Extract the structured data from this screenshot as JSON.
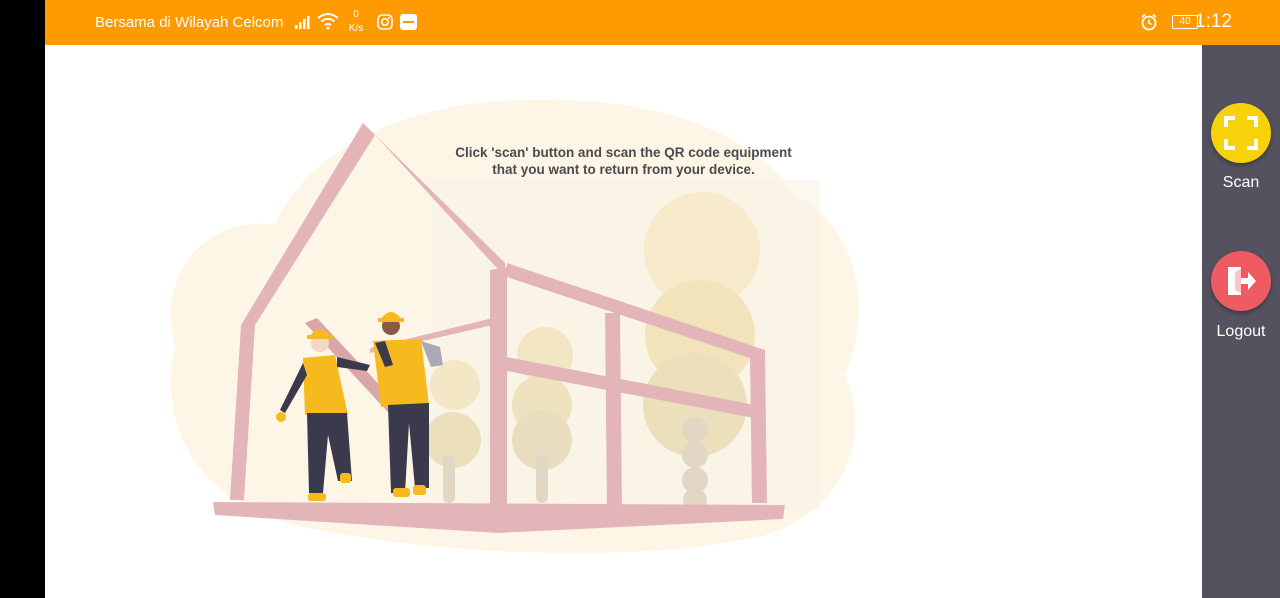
{
  "status_bar": {
    "carrier": "Bersama di Wilayah Celcom",
    "speed_value": "0",
    "speed_unit": "K/s",
    "battery": "40",
    "time": "1:12",
    "icons": [
      "signal-icon",
      "wifi-icon",
      "instagram-icon",
      "notification-app-icon",
      "alarm-icon",
      "battery-icon"
    ],
    "background_color": "#ff9a00"
  },
  "main": {
    "instruction_line1": "Click 'scan' button and scan the QR code equipment",
    "instruction_line2": "that you want to return from your device.",
    "illustration": "construction-workers-house-frame-illustration"
  },
  "side_rail": {
    "background_color": "#54525f",
    "scan": {
      "label": "Scan",
      "icon": "scan-frame-icon",
      "color": "#f5d20a"
    },
    "logout": {
      "label": "Logout",
      "icon": "logout-icon",
      "color": "#ef5b62"
    }
  }
}
